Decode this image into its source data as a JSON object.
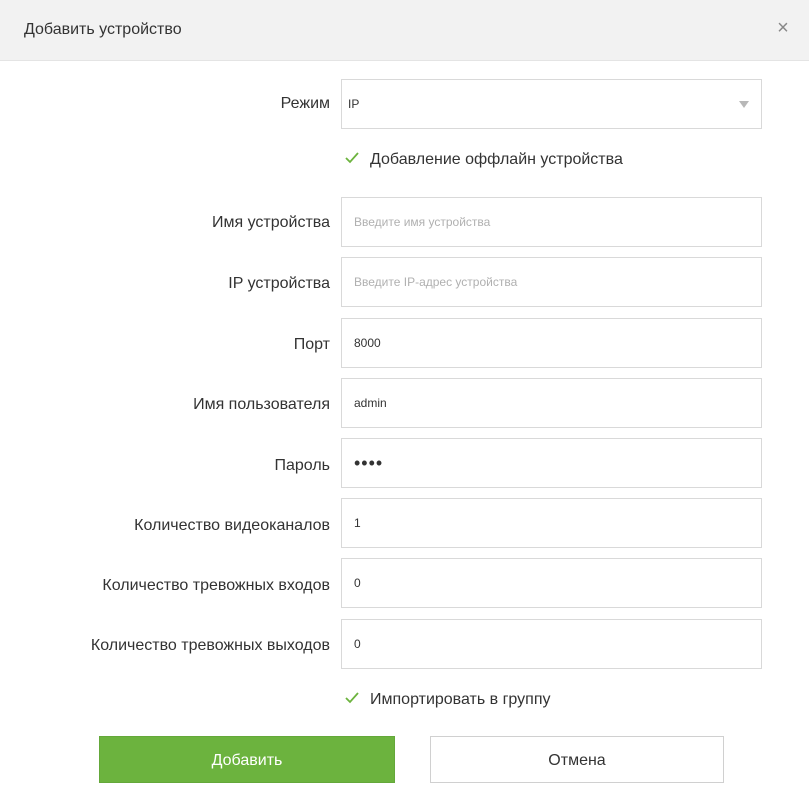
{
  "dialog": {
    "title": "Добавить устройство",
    "close_label": "×"
  },
  "form": {
    "mode": {
      "label": "Режим",
      "value": "IP"
    },
    "offline": {
      "label": "Добавление оффлайн устройства",
      "checked": true
    },
    "device_name": {
      "label": "Имя устройства",
      "value": "",
      "placeholder": "Введите имя устройства"
    },
    "device_ip": {
      "label": "IP устройства",
      "value": "",
      "placeholder": "Введите IP-адрес устройства"
    },
    "port": {
      "label": "Порт",
      "value": "8000"
    },
    "username": {
      "label": "Имя пользователя",
      "value": "admin"
    },
    "password": {
      "label": "Пароль",
      "value": "••••"
    },
    "video_channels": {
      "label": "Количество видеоканалов",
      "value": "1"
    },
    "alarm_inputs": {
      "label": "Количество тревожных входов",
      "value": "0"
    },
    "alarm_outputs": {
      "label": "Количество тревожных выходов",
      "value": "0"
    },
    "import_group": {
      "label": "Импортировать в группу",
      "checked": true
    }
  },
  "buttons": {
    "add": "Добавить",
    "cancel": "Отмена"
  },
  "colors": {
    "accent": "#6cb33e",
    "checkmark": "#6cb33e"
  }
}
